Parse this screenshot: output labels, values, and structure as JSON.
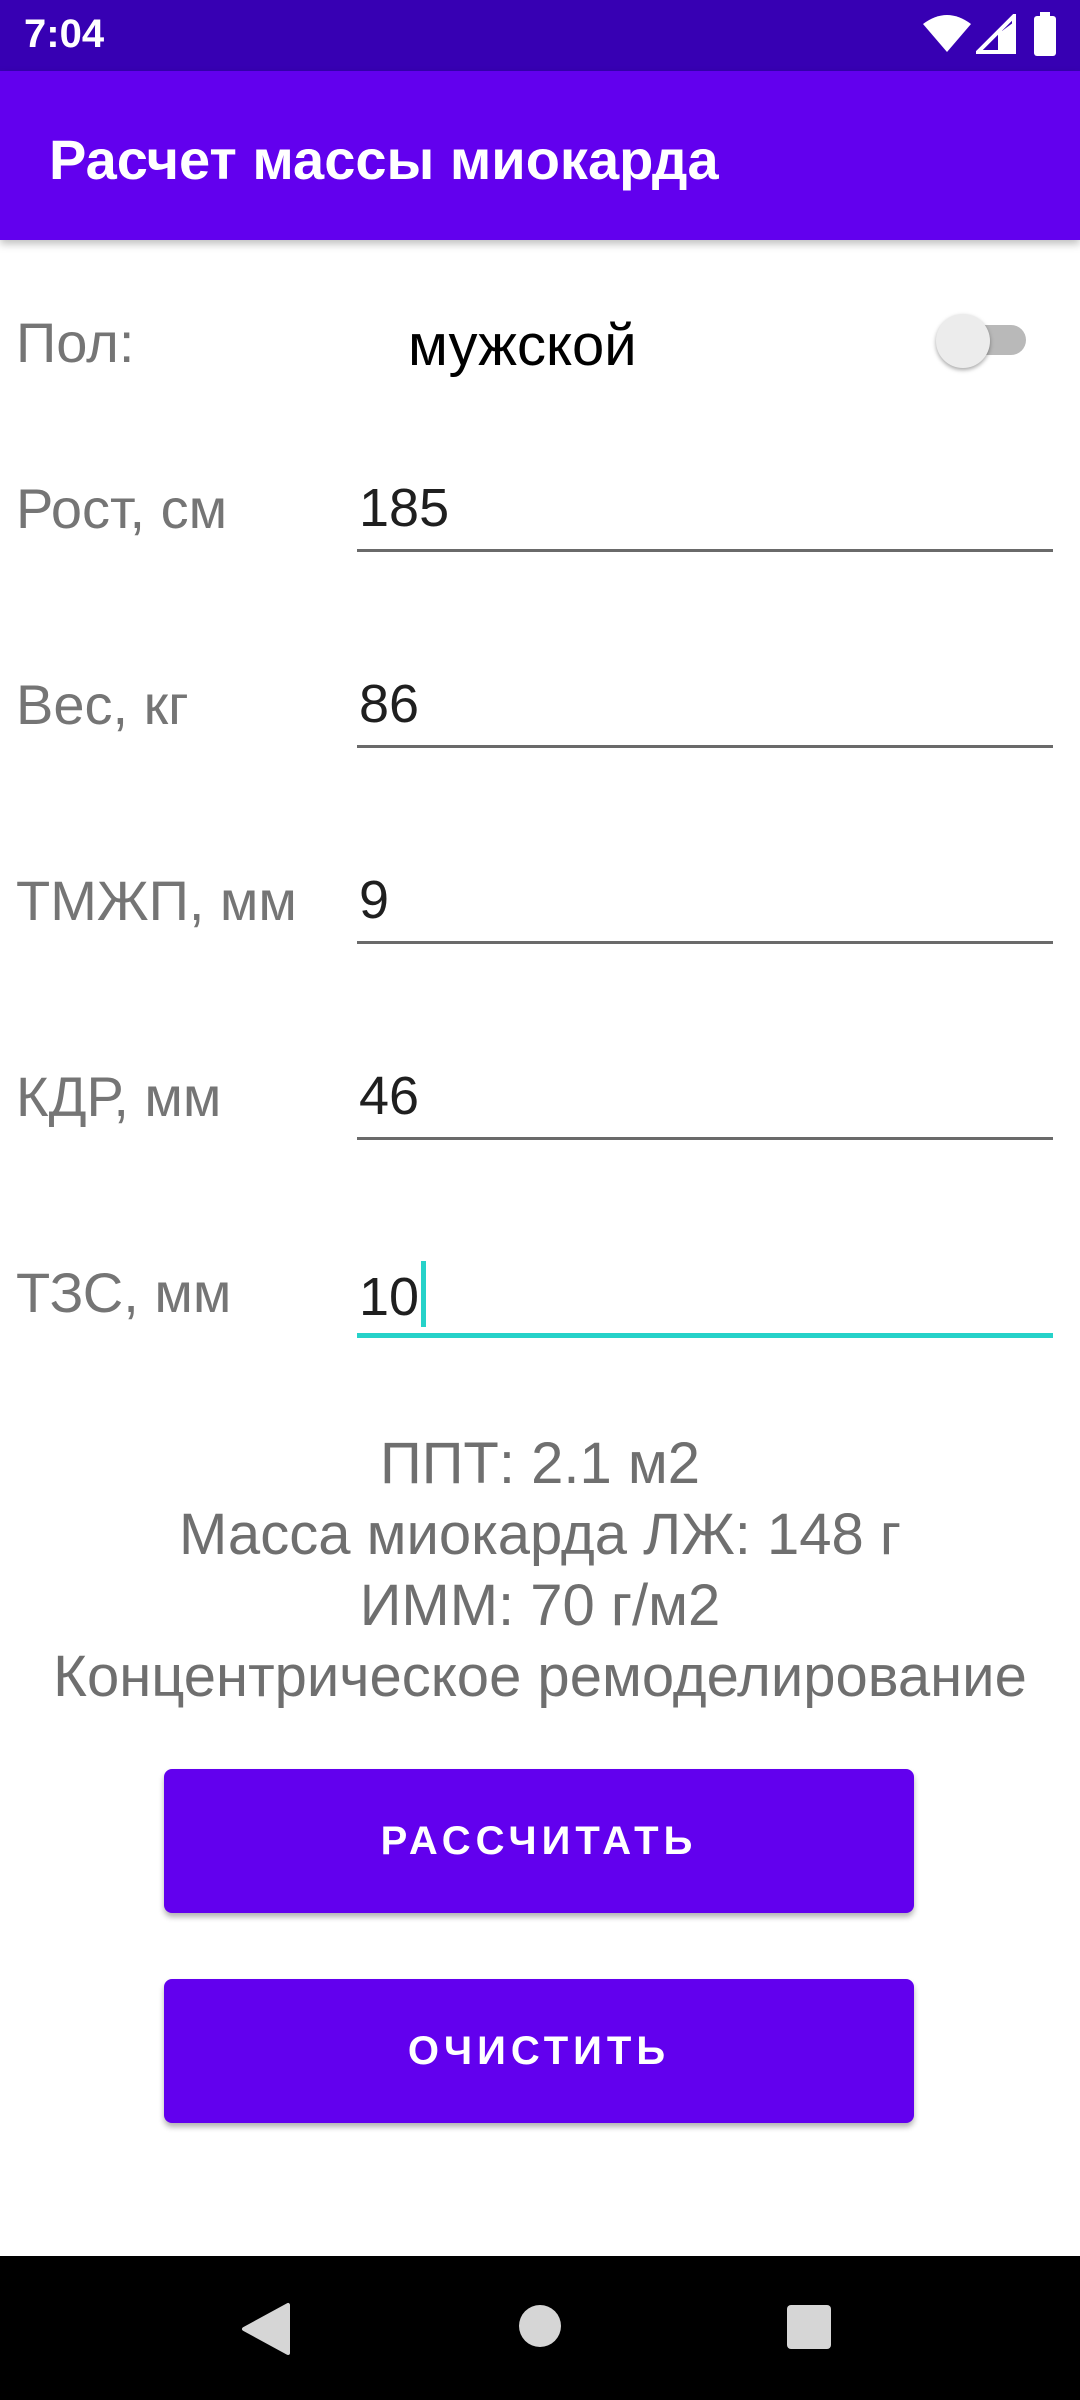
{
  "status_bar": {
    "time": "7:04",
    "icons": [
      "wifi-icon",
      "signal-icon",
      "battery-icon"
    ]
  },
  "app_bar": {
    "title": "Расчет массы миокарда"
  },
  "form": {
    "sex": {
      "label": "Пол:",
      "value": "мужской",
      "switch_on": false
    },
    "height": {
      "label": "Рост, см",
      "value": "185"
    },
    "weight": {
      "label": "Вес, кг",
      "value": "86"
    },
    "ivs": {
      "label": "ТМЖП, мм",
      "value": "9"
    },
    "edd": {
      "label": "КДР, мм",
      "value": "46"
    },
    "pw": {
      "label": "ТЗС, мм",
      "value": "10"
    }
  },
  "results": {
    "bsa": "ППТ: 2.1 м2",
    "lv_mass": "Масса миокарда ЛЖ: 148 г",
    "lvmi": "ИММ: 70 г/м2",
    "geometry": "Концентрическое ремоделирование"
  },
  "buttons": {
    "calculate": "РАССЧИТАТЬ",
    "clear": "ОЧИСТИТЬ"
  },
  "nav_bar": {
    "icons": [
      "back-icon",
      "home-icon",
      "recents-icon"
    ]
  },
  "colors": {
    "primary": "#6200ee",
    "primary_dark": "#3700b3",
    "accent": "#26d2c9"
  }
}
